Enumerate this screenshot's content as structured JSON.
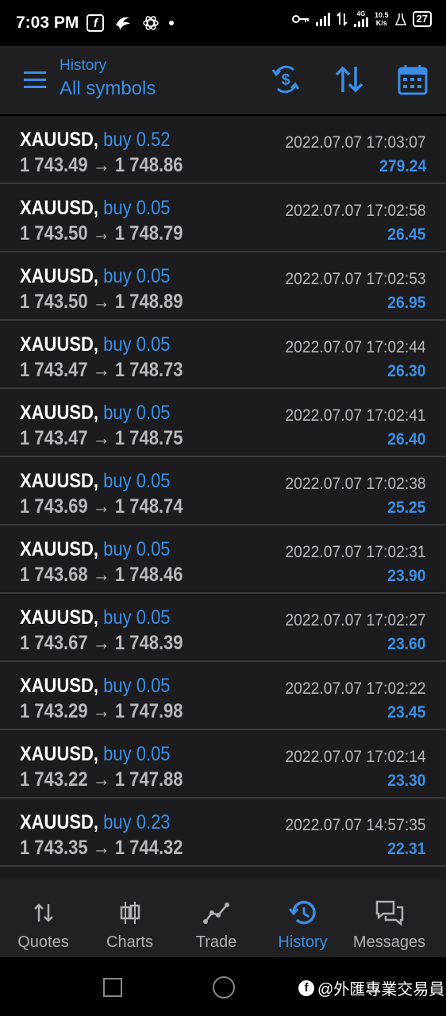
{
  "status_bar": {
    "time": "7:03 PM",
    "net_speed_value": "10.5",
    "net_speed_unit": "K/s",
    "network_type": "4G",
    "battery": "27"
  },
  "header": {
    "subtitle": "History",
    "title": "All symbols",
    "icons": [
      "menu-icon",
      "currency-exchange-icon",
      "sort-icon",
      "calendar-icon"
    ]
  },
  "accent_color": "#3b8ee6",
  "deals": [
    {
      "symbol": "XAUUSD,",
      "side": "buy 0.52",
      "open": "1 743.49",
      "arrow": "→",
      "close": "1 748.86",
      "date": "2022.07.07 17:03:07",
      "profit": "279.24"
    },
    {
      "symbol": "XAUUSD,",
      "side": "buy 0.05",
      "open": "1 743.50",
      "arrow": "→",
      "close": "1 748.79",
      "date": "2022.07.07 17:02:58",
      "profit": "26.45"
    },
    {
      "symbol": "XAUUSD,",
      "side": "buy 0.05",
      "open": "1 743.50",
      "arrow": "→",
      "close": "1 748.89",
      "date": "2022.07.07 17:02:53",
      "profit": "26.95"
    },
    {
      "symbol": "XAUUSD,",
      "side": "buy 0.05",
      "open": "1 743.47",
      "arrow": "→",
      "close": "1 748.73",
      "date": "2022.07.07 17:02:44",
      "profit": "26.30"
    },
    {
      "symbol": "XAUUSD,",
      "side": "buy 0.05",
      "open": "1 743.47",
      "arrow": "→",
      "close": "1 748.75",
      "date": "2022.07.07 17:02:41",
      "profit": "26.40"
    },
    {
      "symbol": "XAUUSD,",
      "side": "buy 0.05",
      "open": "1 743.69",
      "arrow": "→",
      "close": "1 748.74",
      "date": "2022.07.07 17:02:38",
      "profit": "25.25"
    },
    {
      "symbol": "XAUUSD,",
      "side": "buy 0.05",
      "open": "1 743.68",
      "arrow": "→",
      "close": "1 748.46",
      "date": "2022.07.07 17:02:31",
      "profit": "23.90"
    },
    {
      "symbol": "XAUUSD,",
      "side": "buy 0.05",
      "open": "1 743.67",
      "arrow": "→",
      "close": "1 748.39",
      "date": "2022.07.07 17:02:27",
      "profit": "23.60"
    },
    {
      "symbol": "XAUUSD,",
      "side": "buy 0.05",
      "open": "1 743.29",
      "arrow": "→",
      "close": "1 747.98",
      "date": "2022.07.07 17:02:22",
      "profit": "23.45"
    },
    {
      "symbol": "XAUUSD,",
      "side": "buy 0.05",
      "open": "1 743.22",
      "arrow": "→",
      "close": "1 747.88",
      "date": "2022.07.07 17:02:14",
      "profit": "23.30"
    },
    {
      "symbol": "XAUUSD,",
      "side": "buy 0.23",
      "open": "1 743.35",
      "arrow": "→",
      "close": "1 744.32",
      "date": "2022.07.07 14:57:35",
      "profit": "22.31"
    }
  ],
  "bottom_nav": [
    {
      "label": "Quotes",
      "icon": "quotes-arrows-icon",
      "active": false
    },
    {
      "label": "Charts",
      "icon": "candlestick-icon",
      "active": false
    },
    {
      "label": "Trade",
      "icon": "trade-line-icon",
      "active": false
    },
    {
      "label": "History",
      "icon": "history-clock-icon",
      "active": true
    },
    {
      "label": "Messages",
      "icon": "messages-icon",
      "active": false
    }
  ],
  "watermark": "@外匯專業交易員"
}
